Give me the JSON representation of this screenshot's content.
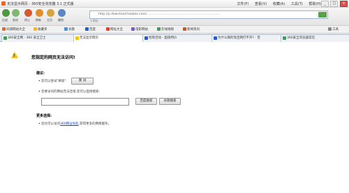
{
  "window": {
    "title": "无法显示网页 - 360安全浏览器 3.1 正式版",
    "menus": [
      "文件(F)",
      "查看(V)",
      "收藏(A)",
      "工具(T)",
      "帮助(H)"
    ],
    "controls": [
      "_",
      "□",
      "✕"
    ]
  },
  "nav": {
    "buttons": [
      "后退",
      "前进",
      "停止",
      "刷新",
      "主页",
      "撤销"
    ],
    "address": "http://p.download.taobao.com/.........................................................................",
    "address_caption": "ℹ 地址"
  },
  "favorites": {
    "items": [
      "同城网站大全",
      "收藏夹",
      "谷歌",
      "百度",
      "网址大全",
      "电影网站",
      "在线视频",
      "新闻资讯",
      "工具"
    ]
  },
  "tabs": [
    {
      "label": "360安全网 - 360 安全卫士"
    },
    {
      "label": "无法显示网页"
    },
    {
      "label": "抢购活动 - 超值特价"
    },
    {
      "label": "为什么我的淘宝网打不开? - 百"
    },
    {
      "label": "360安全浏览器常见"
    }
  ],
  "page": {
    "title": "您指定的网页无法访问!",
    "suggest_head": "建议:",
    "suggest1": "您可以尝试\"刷新\"",
    "refresh_btn": "重 试",
    "suggest2": "您要访问的网站无法连接,您可以直接搜索:",
    "search_btn1": "百度搜索",
    "search_btn2": "谷歌搜索",
    "more_head": "更多选择:",
    "more_text_pre": "您也可以访问",
    "more_link": "360网址导航",
    "more_text_post": ",获得更多的网络服务。"
  },
  "colors": {
    "warning": "#f4c20d",
    "link": "#1a4fb3",
    "go_button": "#56a24a"
  }
}
